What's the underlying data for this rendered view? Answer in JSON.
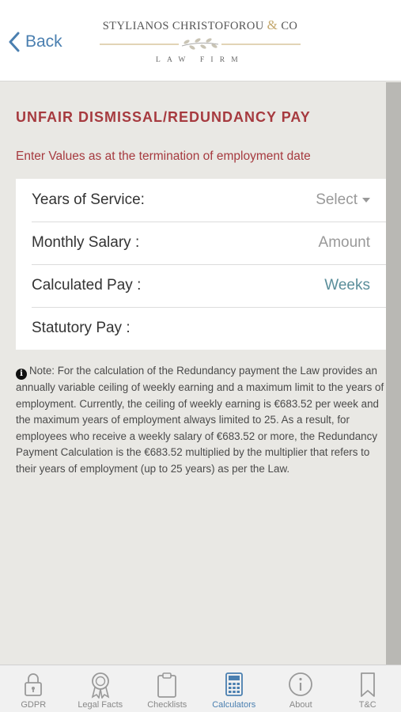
{
  "header": {
    "back_label": "Back",
    "logo": {
      "name_part1": "STYLIANOS CHRISTOFOROU",
      "ampersand": "&",
      "name_part2": "CO",
      "subtitle": "LAW FIRM"
    }
  },
  "main": {
    "title": "UNFAIR DISMISSAL/REDUNDANCY PAY",
    "subtitle": "Enter Values as at the termination of employment date",
    "form": {
      "years_of_service": {
        "label": "Years of Service:",
        "value": "Select"
      },
      "monthly_salary": {
        "label": "Monthly Salary :",
        "placeholder": "Amount"
      },
      "calculated_pay": {
        "label": "Calculated Pay :",
        "value": "Weeks"
      },
      "statutory_pay": {
        "label": "Statutory Pay :",
        "value": ""
      }
    },
    "note": "Note: For the calculation of the Redundancy payment the Law provides an annually variable ceiling of weekly earning and a maximum limit to the years of employment. Currently, the ceiling of weekly earning is €683.52 per week and the maximum years of employment always limited to 25. As a result, for employees who receive a weekly salary of €683.52 or more, the Redundancy Payment Calculation is the €683.52 multiplied by the multiplier that refers to their years of employment (up to 25 years) as per the Law."
  },
  "tabs": [
    {
      "label": "GDPR",
      "icon": "lock-icon"
    },
    {
      "label": "Legal Facts",
      "icon": "award-icon"
    },
    {
      "label": "Checklists",
      "icon": "clipboard-icon"
    },
    {
      "label": "Calculators",
      "icon": "calculator-icon",
      "active": true
    },
    {
      "label": "About",
      "icon": "info-icon"
    },
    {
      "label": "T&C",
      "icon": "bookmark-icon"
    }
  ],
  "colors": {
    "accent": "#4a7fb0",
    "title_red": "#a63a3f",
    "value_teal": "#5a8e9a",
    "logo_gold": "#c4a86e",
    "background": "#e9e8e4"
  }
}
